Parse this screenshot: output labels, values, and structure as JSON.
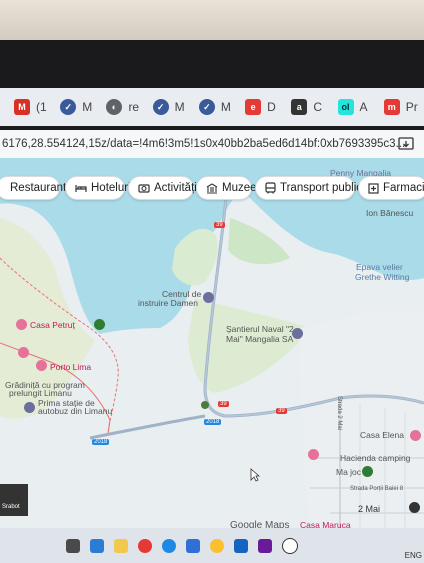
{
  "browser": {
    "tabs": [
      {
        "icon": "gmail-icon",
        "label": "(1",
        "color": "#d93025"
      },
      {
        "icon": "shield-icon",
        "label": "M",
        "color": "#3b5a9a"
      },
      {
        "icon": "globe-icon",
        "label": "re",
        "color": "#5f6368"
      },
      {
        "icon": "shield-icon",
        "label": "M",
        "color": "#3b5a9a"
      },
      {
        "icon": "shield-icon",
        "label": "M",
        "color": "#3b5a9a"
      },
      {
        "icon": "emag-icon",
        "label": "D",
        "color": "#e53935"
      },
      {
        "icon": "app-icon",
        "label": "C",
        "color": "#333333"
      },
      {
        "icon": "olx-icon",
        "label": "A",
        "color": "#23e5db"
      },
      {
        "icon": "m-icon",
        "label": "Pr",
        "color": "#e53935"
      }
    ],
    "url": "6176,28.554124,15z/data=!4m6!3m5!1s0x40bb2ba5ed6d14bf:0xb7693395c3..."
  },
  "map": {
    "chips": [
      {
        "label": "Restaurante",
        "icon": "fork-knife-icon"
      },
      {
        "label": "Hoteluri",
        "icon": "bed-icon"
      },
      {
        "label": "Activități",
        "icon": "camera-icon"
      },
      {
        "label": "Muzee",
        "icon": "museum-icon"
      },
      {
        "label": "Transport public",
        "icon": "bus-icon"
      },
      {
        "label": "Farmacii",
        "icon": "pharmacy-icon"
      }
    ],
    "labels": {
      "penny": "Penny Mangalia",
      "ion_banescu": "Ion Bănescu",
      "epava": "Epava velier",
      "grethe": "Grethe Witting",
      "centrul": "Centrul de",
      "instruire": "instruire Damen",
      "santierul1": "Șantierul Naval \"2",
      "santierul2": "Mai\" Mangalia SA",
      "casa_petrut": "Casa Petruț",
      "porto_lima": "Porto Lima",
      "gradinita1": "Grădiniță cu program",
      "gradinita2": "prelungit Limanu",
      "prima1": "Prima stație de",
      "prima2": "autobuz din Limanu",
      "casa_elena": "Casa Elena",
      "hacienda": "Hacienda camping",
      "ma_joc": "Ma joc",
      "strada_2mai": "Strada 2 Mai",
      "strada_portii": "Strada Porții Baiei 8",
      "doi_mai": "2 Mai",
      "casa_maruca": "Casa Maruca",
      "road_39": "39",
      "road_2018": "2018",
      "google_maps": "Google Maps"
    }
  },
  "taskbar": {
    "lang": "ENG"
  },
  "sidecard": {
    "label": "Srabot"
  }
}
